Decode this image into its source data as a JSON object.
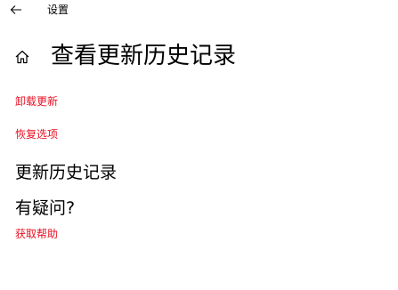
{
  "window": {
    "title": "设置"
  },
  "header": {
    "title": "查看更新历史记录"
  },
  "links": {
    "uninstall_updates": "卸载更新",
    "recovery_options": "恢复选项"
  },
  "history_section": {
    "heading": "更新历史记录"
  },
  "help_section": {
    "heading": "有疑问?",
    "get_help": "获取帮助"
  },
  "icons": {
    "back": "back-arrow-icon",
    "home": "home-icon"
  },
  "colors": {
    "link": "#e81123",
    "text": "#000000",
    "background": "#ffffff"
  }
}
